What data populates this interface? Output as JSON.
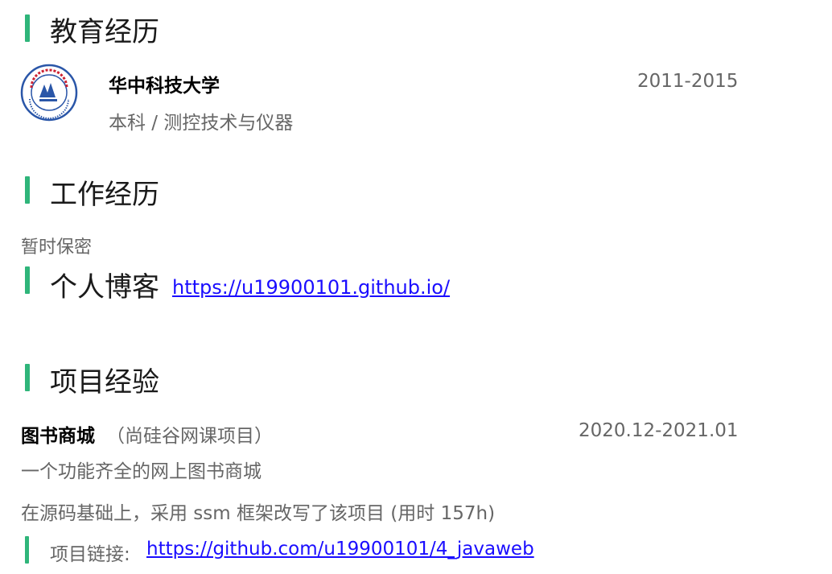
{
  "education": {
    "heading": "教育经历",
    "school": "华中科技大学",
    "degree": "本科 / 测控技术与仪器",
    "years": "2011-2015",
    "logo_icon": "university-seal-icon",
    "logo_text_top": "華中科技大學",
    "logo_text_bottom": "UNIVERSITY OF SCIENCE AND TECHNOLOGY"
  },
  "work": {
    "heading": "工作经历",
    "text": "暂时保密"
  },
  "blog": {
    "heading": "个人博客",
    "url": "https://u19900101.github.io/"
  },
  "projects": {
    "heading": "项目经验",
    "name": "图书商城",
    "source": "（尚硅谷网课项目）",
    "dates": "2020.12-2021.01",
    "desc1": "一个功能齐全的网上图书商城",
    "desc2": "在源码基础上，采用 ssm 框架改写了该项目 (用时 157h)",
    "link_label": "项目链接: ",
    "link_url": "https://github.com/u19900101/4_javaweb"
  },
  "colors": {
    "accent": "#2fb57a",
    "link": "#1a0dff",
    "muted": "#666666"
  }
}
